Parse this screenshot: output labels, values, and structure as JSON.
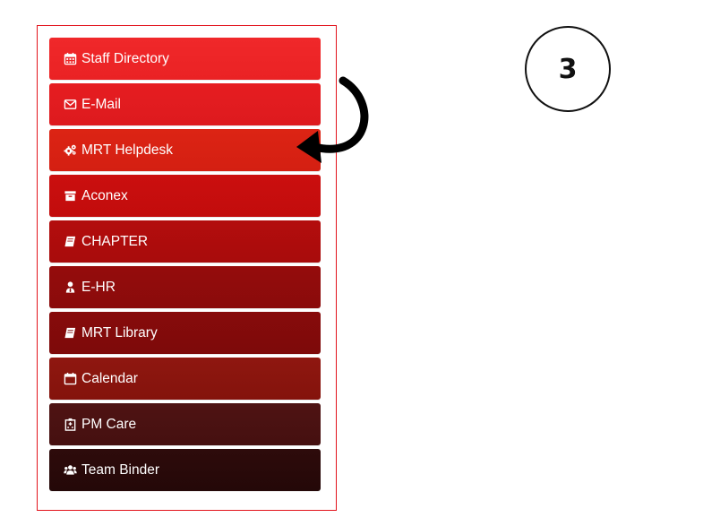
{
  "menu": {
    "items": [
      {
        "label": "Staff Directory",
        "icon": "calendar-grid-icon",
        "color_top": "#f0282a",
        "color_bottom": "#ea2224"
      },
      {
        "label": "E-Mail",
        "icon": "envelope-icon",
        "color_top": "#e61d21",
        "color_bottom": "#dd1a1e"
      },
      {
        "label": "MRT Helpdesk",
        "icon": "gears-icon",
        "color_top": "#dc2414",
        "color_bottom": "#d41f12"
      },
      {
        "label": "Aconex",
        "icon": "archive-icon",
        "color_top": "#cb0f0f",
        "color_bottom": "#c20c0c"
      },
      {
        "label": "CHAPTER",
        "icon": "book-icon",
        "color_top": "#b30d0d",
        "color_bottom": "#a80c0c"
      },
      {
        "label": "E-HR",
        "icon": "user-tie-icon",
        "color_top": "#950c0c",
        "color_bottom": "#8a0b0b"
      },
      {
        "label": "MRT Library",
        "icon": "book-icon",
        "color_top": "#870b0b",
        "color_bottom": "#7d0a0a"
      },
      {
        "label": "Calendar",
        "icon": "calendar-icon",
        "color_top": "#8f1710",
        "color_bottom": "#84130c"
      },
      {
        "label": "PM Care",
        "icon": "hospital-icon",
        "color_top": "#4f1313",
        "color_bottom": "#451010"
      },
      {
        "label": "Team Binder",
        "icon": "users-icon",
        "color_top": "#2e0b0b",
        "color_bottom": "#240808"
      }
    ]
  },
  "step": {
    "number": "3"
  },
  "colors": {
    "panel_border": "#e2121b",
    "arrow": "#000000"
  }
}
